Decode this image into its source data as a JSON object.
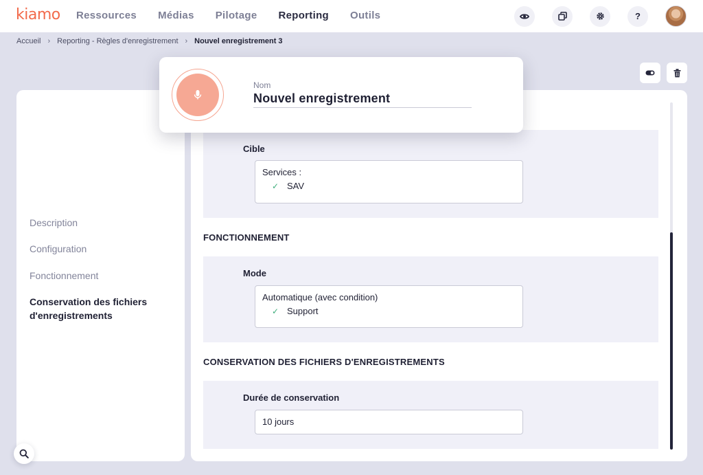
{
  "app": {
    "logo_text": "kiamo",
    "brand_color": "#f26a4b"
  },
  "nav": {
    "items": [
      {
        "label": "Ressources"
      },
      {
        "label": "Médias"
      },
      {
        "label": "Pilotage"
      },
      {
        "label": "Reporting",
        "active": true
      },
      {
        "label": "Outils"
      }
    ]
  },
  "top_actions": {
    "preview_icon": "eye-icon",
    "windows_icon": "windows-icon",
    "settings_icon": "gear-icon",
    "help_label": "?"
  },
  "breadcrumb": {
    "items": [
      "Accueil",
      "Reporting - Règles d'enregistrement",
      "Nouvel enregistrement 3"
    ]
  },
  "record_actions": {
    "toggle_icon": "toggle-icon",
    "delete_icon": "trash-icon"
  },
  "name_card": {
    "label": "Nom",
    "value": "Nouvel enregistrement",
    "icon": "microphone-icon"
  },
  "sidebar": {
    "items": [
      {
        "label": "Description"
      },
      {
        "label": "Configuration"
      },
      {
        "label": "Fonctionnement"
      },
      {
        "label": "Conservation des fichiers d'enregistrements",
        "active": true
      }
    ]
  },
  "sections": {
    "cible": {
      "label": "Cible",
      "heading": "Services :",
      "checked": "SAV"
    },
    "fonctionnement": {
      "title": "FONCTIONNEMENT",
      "mode_label": "Mode",
      "mode_value": "Automatique (avec condition)",
      "checked": "Support"
    },
    "conservation": {
      "title": "CONSERVATION DES FICHIERS D'ENREGISTREMENTS",
      "duration_label": "Durée de conservation",
      "duration_value": "10 jours"
    }
  },
  "search": {
    "icon": "search-icon"
  }
}
